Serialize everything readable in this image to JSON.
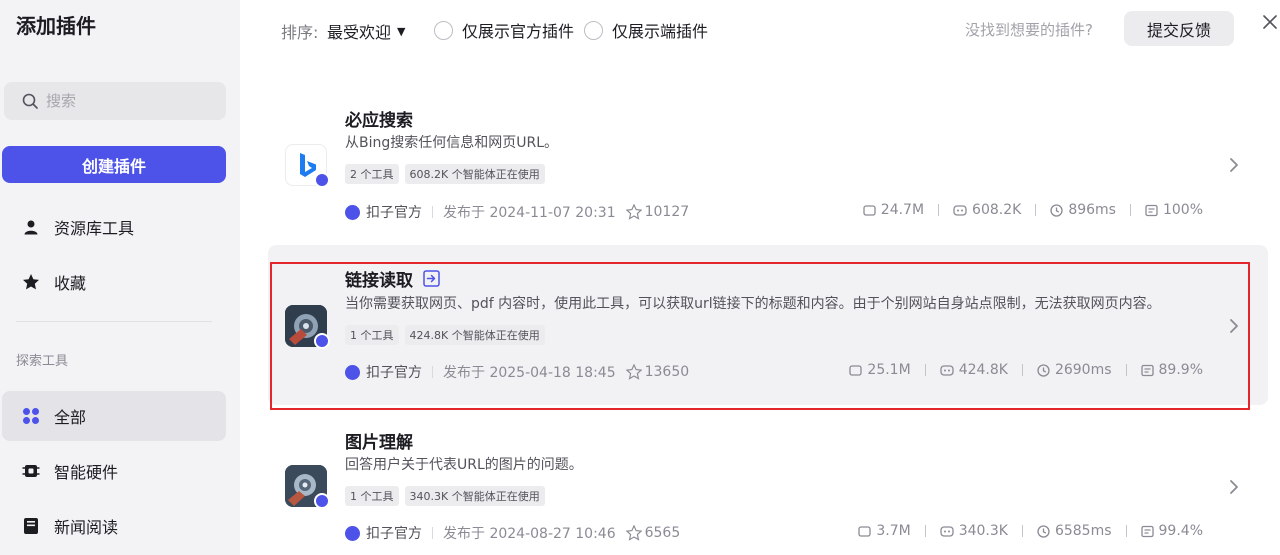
{
  "sidebar": {
    "title": "添加插件",
    "search_placeholder": "搜索",
    "create_button": "创建插件",
    "items": [
      {
        "label": "资源库工具",
        "icon": "user-icon"
      },
      {
        "label": "收藏",
        "icon": "star-icon"
      }
    ],
    "section_label": "探索工具",
    "explore_items": [
      {
        "label": "全部",
        "icon": "grid-icon",
        "active": true
      },
      {
        "label": "智能硬件",
        "icon": "chip-icon"
      },
      {
        "label": "新闻阅读",
        "icon": "book-icon"
      }
    ]
  },
  "topbar": {
    "sort_label": "排序:",
    "sort_value": "最受欢迎",
    "filter_official": "仅展示官方插件",
    "filter_device": "仅展示端插件",
    "not_found": "没找到想要的插件?",
    "feedback_button": "提交反馈"
  },
  "plugins": [
    {
      "title": "必应搜索",
      "description": "从Bing搜索任何信息和网页URL。",
      "tag_tools": "2 个工具",
      "tag_usage": "608.2K 个智能体正在使用",
      "publisher": "扣子官方",
      "published": "发布于 2024-11-07 20:31",
      "stars": "10127",
      "calls": "24.7M",
      "bots": "608.2K",
      "latency": "896ms",
      "success": "100%",
      "logo": "bing-logo"
    },
    {
      "title": "链接读取",
      "description": "当你需要获取网页、pdf 内容时，使用此工具，可以获取url链接下的标题和内容。由于个别网站自身站点限制，无法获取网页内容。",
      "tag_tools": "1 个工具",
      "tag_usage": "424.8K 个智能体正在使用",
      "publisher": "扣子官方",
      "published": "发布于 2025-04-18 18:45",
      "stars": "13650",
      "calls": "25.1M",
      "bots": "424.8K",
      "latency": "2690ms",
      "success": "89.9%",
      "logo": "robot-logo"
    },
    {
      "title": "图片理解",
      "description": "回答用户关于代表URL的图片的问题。",
      "tag_tools": "1 个工具",
      "tag_usage": "340.3K 个智能体正在使用",
      "publisher": "扣子官方",
      "published": "发布于 2024-08-27 10:46",
      "stars": "6565",
      "calls": "3.7M",
      "bots": "340.3K",
      "latency": "6585ms",
      "success": "99.4%",
      "logo": "robot-logo"
    }
  ],
  "colors": {
    "accent": "#4d53e8",
    "highlight_border": "#e3262b",
    "sidebar_bg": "#f3f3f5"
  }
}
